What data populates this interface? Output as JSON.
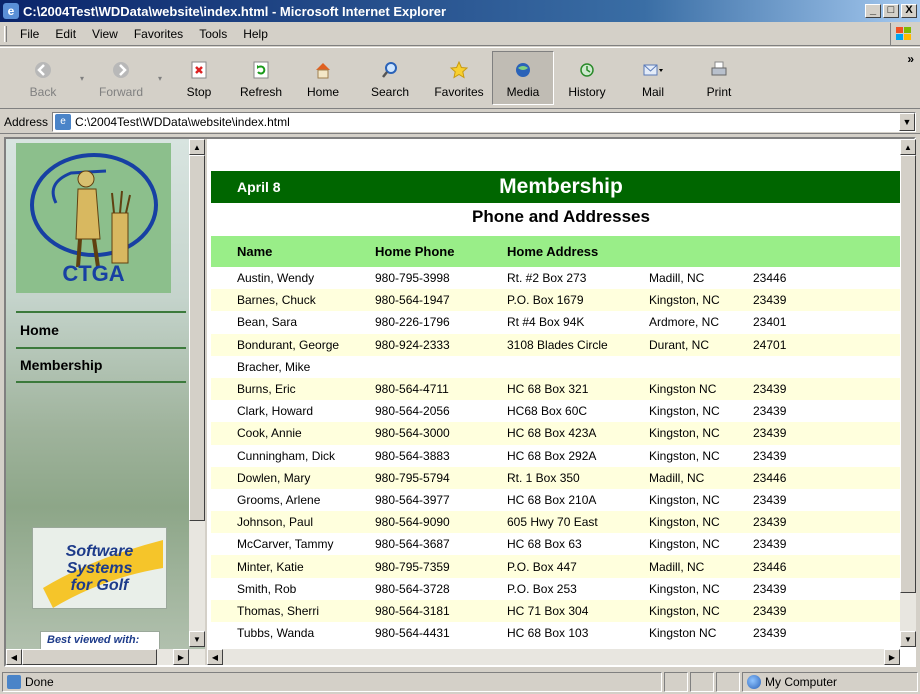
{
  "window": {
    "title": "C:\\2004Test\\WDData\\website\\index.html - Microsoft Internet Explorer",
    "controls": {
      "minimize": "_",
      "maximize": "□",
      "close": "X"
    }
  },
  "menu": [
    "File",
    "Edit",
    "View",
    "Favorites",
    "Tools",
    "Help"
  ],
  "toolbar": {
    "back": "Back",
    "forward": "Forward",
    "stop": "Stop",
    "refresh": "Refresh",
    "home": "Home",
    "search": "Search",
    "favorites": "Favorites",
    "media": "Media",
    "history": "History",
    "mail": "Mail",
    "print": "Print"
  },
  "address": {
    "label": "Address",
    "value": "C:\\2004Test\\WDData\\website\\index.html"
  },
  "sidebar": {
    "logo_text": "CTGA",
    "nav": [
      "Home",
      "Membership"
    ],
    "sponsor": [
      "Software",
      "Systems",
      "for Golf"
    ],
    "best_viewed": "Best viewed with:"
  },
  "page": {
    "date": "April 8",
    "title": "Membership",
    "subtitle": "Phone and Addresses",
    "columns": {
      "name": "Name",
      "phone": "Home Phone",
      "address": "Home Address"
    },
    "members": [
      [
        "Austin, Wendy",
        "980-795-3998",
        "Rt. #2 Box 273",
        "Madill, NC",
        "23446"
      ],
      [
        "Barnes, Chuck",
        "980-564-1947",
        "P.O. Box 1679",
        "Kingston, NC",
        "23439"
      ],
      [
        "Bean, Sara",
        "980-226-1796",
        "Rt #4 Box 94K",
        "Ardmore, NC",
        "23401"
      ],
      [
        "Bondurant, George",
        "980-924-2333",
        "3108 Blades Circle",
        "Durant, NC",
        "24701"
      ],
      [
        "Bracher, Mike",
        "",
        "",
        "",
        ""
      ],
      [
        "Burns, Eric",
        "980-564-4711",
        "HC 68 Box 321",
        "Kingston NC",
        "23439"
      ],
      [
        "Clark, Howard",
        "980-564-2056",
        "HC68 Box 60C",
        "Kingston, NC",
        "23439"
      ],
      [
        "Cook, Annie",
        "980-564-3000",
        "HC 68 Box 423A",
        "Kingston, NC",
        "23439"
      ],
      [
        "Cunningham, Dick",
        "980-564-3883",
        "HC 68 Box 292A",
        "Kingston, NC",
        "23439"
      ],
      [
        "Dowlen, Mary",
        "980-795-5794",
        "Rt. 1 Box 350",
        "Madill, NC",
        "23446"
      ],
      [
        "Grooms, Arlene",
        "980-564-3977",
        "HC 68 Box 210A",
        "Kingston, NC",
        "23439"
      ],
      [
        "Johnson, Paul",
        "980-564-9090",
        "605 Hwy 70 East",
        "Kingston, NC",
        "23439"
      ],
      [
        "McCarver, Tammy",
        "980-564-3687",
        "HC 68 Box 63",
        "Kingston, NC",
        "23439"
      ],
      [
        "Minter, Katie",
        "980-795-7359",
        "P.O. Box 447",
        "Madill, NC",
        "23446"
      ],
      [
        "Smith, Rob",
        "980-564-3728",
        "P.O. Box 253",
        "Kingston, NC",
        "23439"
      ],
      [
        "Thomas, Sherri",
        "980-564-3181",
        "HC 71 Box 304",
        "Kingston, NC",
        "23439"
      ],
      [
        "Tubbs, Wanda",
        "980-564-4431",
        "HC 68 Box 103",
        "Kingston NC",
        "23439"
      ]
    ]
  },
  "status": {
    "text": "Done",
    "zone": "My Computer"
  },
  "colors": {
    "header_green": "#006600",
    "column_header_green": "#99ee88",
    "row_stripe": "#ffffdd",
    "nav_rule": "#3c7a3c",
    "logo_blue": "#1740a3"
  }
}
